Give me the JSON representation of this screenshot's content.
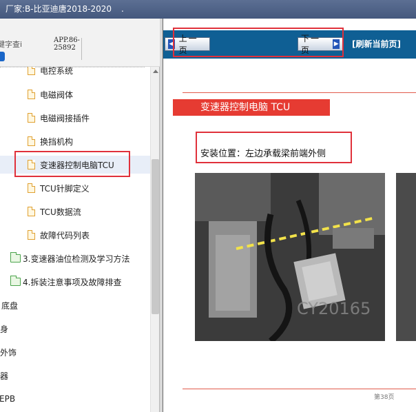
{
  "window": {
    "title": "厂家:B-比亚迪唐2018-2020",
    "title_suffix": "."
  },
  "search": {
    "placeholder": "键字查i"
  },
  "app_id": {
    "line1": "APP.86-",
    "line2": "25892"
  },
  "tree": {
    "items": [
      {
        "label": "电控系统",
        "icon": "document-icon"
      },
      {
        "label": "电磁阀体",
        "icon": "document-icon"
      },
      {
        "label": "电磁阀接插件",
        "icon": "document-icon"
      },
      {
        "label": "换挡机构",
        "icon": "document-icon"
      },
      {
        "label": "变速器控制电脑TCU",
        "icon": "document-icon",
        "selected": true
      },
      {
        "label": "TCU针脚定义",
        "icon": "document-icon"
      },
      {
        "label": "TCU数据流",
        "icon": "document-icon"
      },
      {
        "label": "故障代码列表",
        "icon": "document-icon"
      },
      {
        "label": "3.变速器油位检测及学习方法",
        "icon": "folder-icon"
      },
      {
        "label": "4.拆装注意事项及故障排查",
        "icon": "folder-icon"
      },
      {
        "label": "底盘"
      },
      {
        "label": "车身"
      },
      {
        "label": "内外饰"
      },
      {
        "label": "电器"
      },
      {
        "label": "EPB"
      }
    ]
  },
  "viewer": {
    "prev_label": "上一页",
    "next_label": "下一页",
    "refresh_label": "[刷新当前页]",
    "heading": "变速器控制电脑 TCU",
    "install_text": "安装位置：左边承载梁前端外侧",
    "watermark": "CY20165",
    "page_number": "第38页"
  },
  "colors": {
    "nav_bar": "#0f5f94",
    "heading_bg": "#e63b32",
    "highlight": "#e0303a",
    "title_bar": "#4a5e84"
  }
}
